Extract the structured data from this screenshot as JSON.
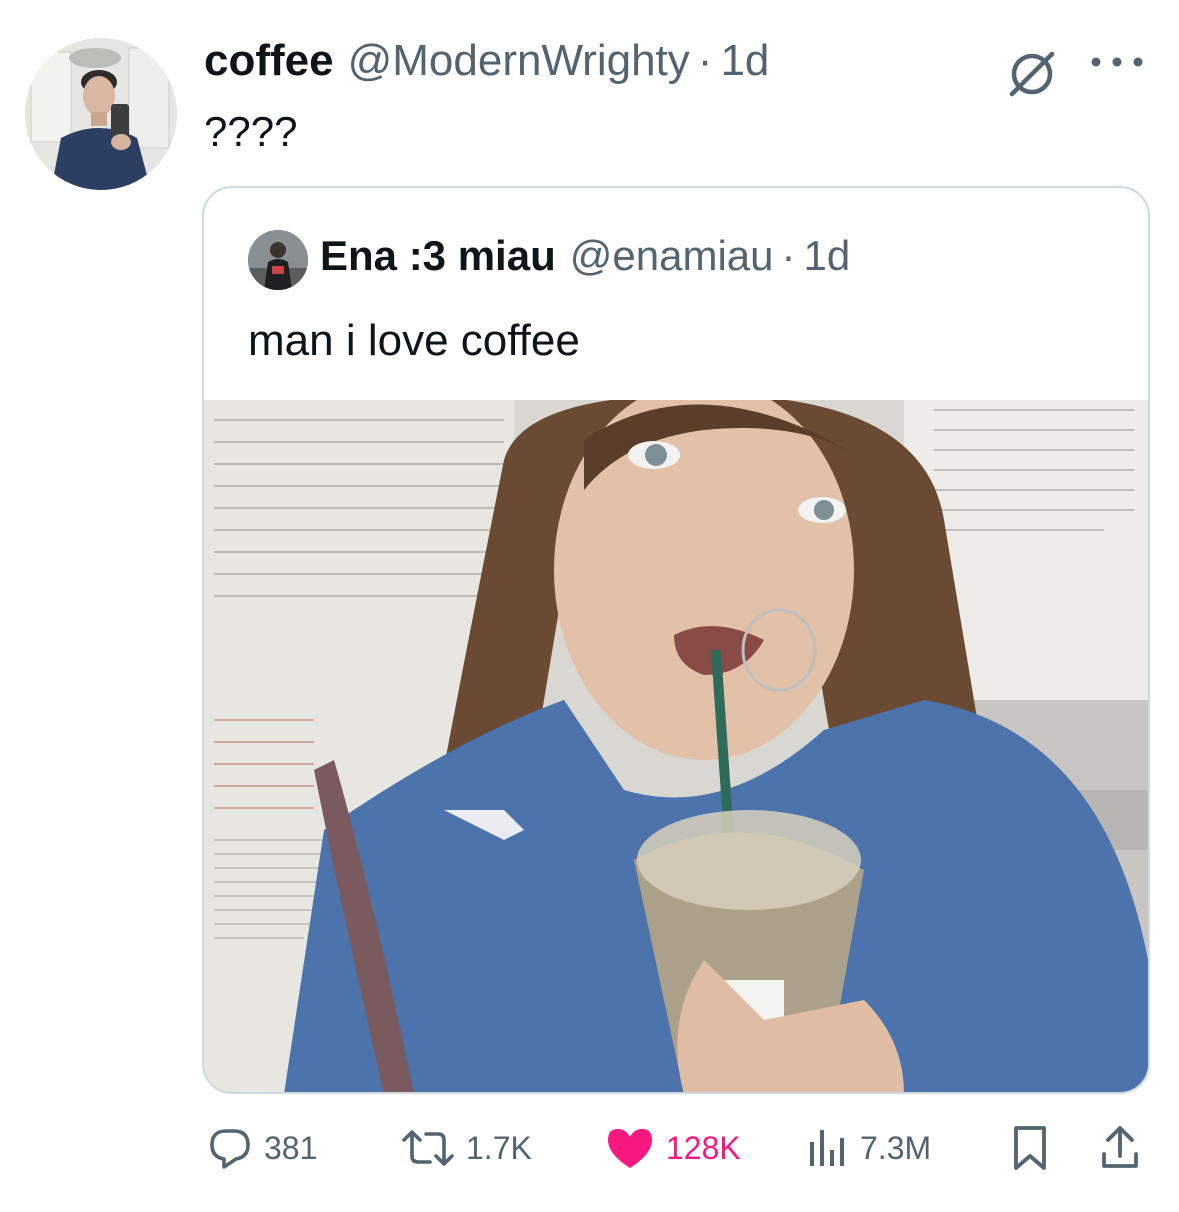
{
  "tweet": {
    "author": {
      "name": "coffee",
      "handle": "@ModernWrighty",
      "time": "1d",
      "avatar_icon": "person-mirror-selfie"
    },
    "separator": "·",
    "text": "????",
    "header_icons": {
      "muted": "no-entry-icon",
      "more": "more-icon"
    }
  },
  "quote": {
    "author": {
      "name": "Ena :3 miau",
      "handle": "@enamiau",
      "time": "1d",
      "avatar_icon": "person-avatar"
    },
    "separator": "·",
    "text": "man i love coffee",
    "media": {
      "type": "photo",
      "subject": "selfie-with-iced-coffee"
    }
  },
  "actions": {
    "replies": "381",
    "retweets": "1.7K",
    "likes": "128K",
    "views": "7.3M",
    "liked": true,
    "icons": [
      "reply-icon",
      "retweet-icon",
      "heart-icon",
      "views-icon",
      "bookmark-icon",
      "share-icon"
    ]
  },
  "colors": {
    "text": "#0f1419",
    "secondary": "#536471",
    "like": "#f91880",
    "border": "#cfd9de"
  }
}
